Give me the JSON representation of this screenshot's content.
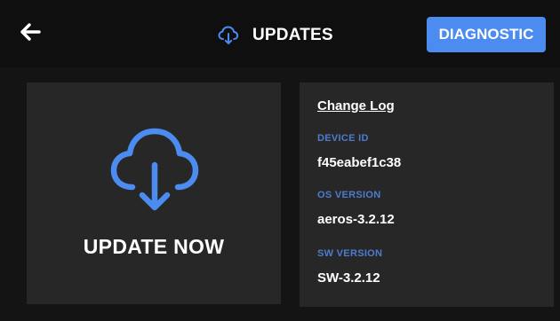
{
  "header": {
    "back_icon": "arrow-left-icon",
    "title_icon": "cloud-download-icon",
    "title": "UPDATES",
    "diagnostic_label": "DIAGNOSTIC"
  },
  "update_card": {
    "icon": "cloud-download-icon",
    "label": "UPDATE NOW"
  },
  "info": {
    "changelog_label": "Change Log",
    "device_id_label": "DEVICE ID",
    "device_id_value": "f45eabef1c38",
    "os_version_label": "OS VERSION",
    "os_version_value": "aeros-3.2.12",
    "sw_version_label": "SW VERSION",
    "sw_version_value": "SW-3.2.12"
  },
  "colors": {
    "accent": "#4c8bf0",
    "label_blue": "#4d7ccf",
    "card_bg": "#272727",
    "page_bg": "#141414",
    "header_bg": "#0f0f0f"
  }
}
